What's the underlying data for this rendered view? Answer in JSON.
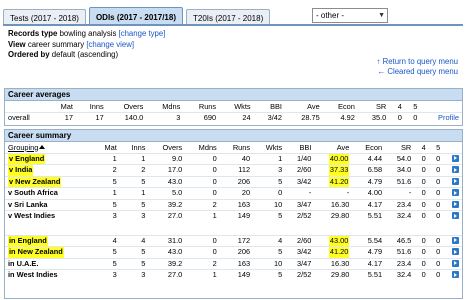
{
  "tabs": [
    {
      "label": "Tests (2017 - 2018)",
      "active": false
    },
    {
      "label": "ODIs (2017 - 2017/18)",
      "active": true
    },
    {
      "label": "T20Is (2017 - 2018)",
      "active": false
    }
  ],
  "other_select": {
    "value": "- other -"
  },
  "query": {
    "records_type_label": "Records type",
    "records_type_value": "bowling analysis",
    "change_type_link": "[change type]",
    "view_label": "View",
    "view_value": "career summary",
    "change_view_link": "[change view]",
    "ordered_label": "Ordered by",
    "ordered_value": "default (ascending)"
  },
  "return_links": {
    "return": "Return to query menu",
    "cleared": "Cleared query menu"
  },
  "career_averages": {
    "title": "Career averages",
    "headers": [
      "",
      "Mat",
      "Inns",
      "Overs",
      "Mdns",
      "Runs",
      "Wkts",
      "BBI",
      "Ave",
      "Econ",
      "SR",
      "4",
      "5",
      ""
    ],
    "row": [
      "overall",
      "17",
      "17",
      "140.0",
      "3",
      "690",
      "24",
      "3/42",
      "28.75",
      "4.92",
      "35.0",
      "0",
      "0",
      "Profile"
    ]
  },
  "career_summary": {
    "title": "Career summary",
    "headers": [
      "Grouping",
      "Mat",
      "Inns",
      "Overs",
      "Mdns",
      "Runs",
      "Wkts",
      "BBI",
      "Ave",
      "Econ",
      "SR",
      "4",
      "5"
    ],
    "group1": [
      {
        "g": "v England",
        "v": [
          "1",
          "1",
          "9.0",
          "0",
          "40",
          "1",
          "1/40",
          "40.00",
          "4.44",
          "54.0",
          "0",
          "0"
        ],
        "hl_name": true,
        "hl_ave": true
      },
      {
        "g": "v India",
        "v": [
          "2",
          "2",
          "17.0",
          "0",
          "112",
          "3",
          "2/60",
          "37.33",
          "6.58",
          "34.0",
          "0",
          "0"
        ],
        "hl_name": true,
        "hl_ave": true
      },
      {
        "g": "v New Zealand",
        "v": [
          "5",
          "5",
          "43.0",
          "0",
          "206",
          "5",
          "3/42",
          "41.20",
          "4.79",
          "51.6",
          "0",
          "0"
        ],
        "hl_name": true,
        "hl_ave": true
      },
      {
        "g": "v South Africa",
        "v": [
          "1",
          "1",
          "5.0",
          "0",
          "20",
          "0",
          "-",
          "-",
          "4.00",
          "-",
          "0",
          "0"
        ],
        "hl_name": false,
        "hl_ave": false
      },
      {
        "g": "v Sri Lanka",
        "v": [
          "5",
          "5",
          "39.2",
          "2",
          "163",
          "10",
          "3/47",
          "16.30",
          "4.17",
          "23.4",
          "0",
          "0"
        ],
        "hl_name": false,
        "hl_ave": false
      },
      {
        "g": "v West Indies",
        "v": [
          "3",
          "3",
          "27.0",
          "1",
          "149",
          "5",
          "2/52",
          "29.80",
          "5.51",
          "32.4",
          "0",
          "0"
        ],
        "hl_name": false,
        "hl_ave": false
      }
    ],
    "group2": [
      {
        "g": "in England",
        "v": [
          "4",
          "4",
          "31.0",
          "0",
          "172",
          "4",
          "2/60",
          "43.00",
          "5.54",
          "46.5",
          "0",
          "0"
        ],
        "hl_name": true,
        "hl_ave": true
      },
      {
        "g": "in New Zealand",
        "v": [
          "5",
          "5",
          "43.0",
          "0",
          "206",
          "5",
          "3/42",
          "41.20",
          "4.79",
          "51.6",
          "0",
          "0"
        ],
        "hl_name": true,
        "hl_ave": true
      },
      {
        "g": "in U.A.E.",
        "v": [
          "5",
          "5",
          "39.2",
          "2",
          "163",
          "10",
          "3/47",
          "16.30",
          "4.17",
          "23.4",
          "0",
          "0"
        ],
        "hl_name": false,
        "hl_ave": false
      },
      {
        "g": "in West Indies",
        "v": [
          "3",
          "3",
          "27.0",
          "1",
          "149",
          "5",
          "2/52",
          "29.80",
          "5.51",
          "32.4",
          "0",
          "0"
        ],
        "hl_name": false,
        "hl_ave": false
      }
    ]
  },
  "colors": {
    "tab_active": "#c8ddf1",
    "highlight": "#ffff00",
    "link": "#1a56c9",
    "bullet": "#2b78c6"
  },
  "icons": {
    "row_bullet": "play-arrow-icon",
    "return": "up-arrow-icon",
    "cleared": "left-arrow-icon"
  }
}
